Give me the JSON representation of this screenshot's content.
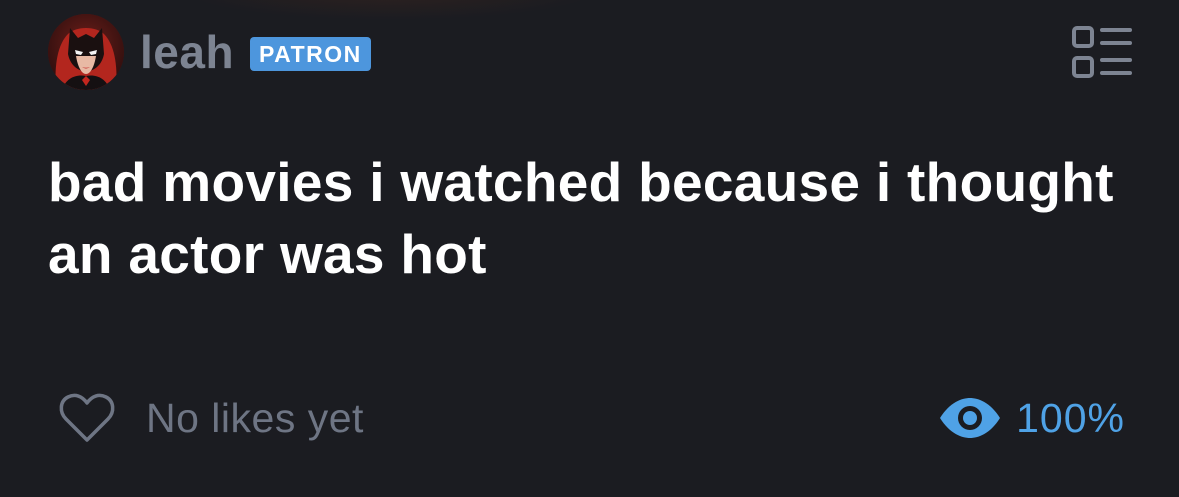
{
  "post": {
    "author": {
      "name": "leah",
      "badge": "PATRON"
    },
    "title": "bad movies i watched because i thought an actor was hot",
    "likes_text": "No likes yet",
    "view_percent": "100%"
  },
  "icons": {
    "avatar": "batwoman-avatar",
    "view_toggle": "list-view-icon",
    "like": "heart-outline-icon",
    "visibility": "eye-icon"
  },
  "colors": {
    "background": "#1b1c21",
    "badge": "#4d96dd",
    "accent_blue": "#4fa2e6",
    "muted_text": "#6e7584"
  }
}
